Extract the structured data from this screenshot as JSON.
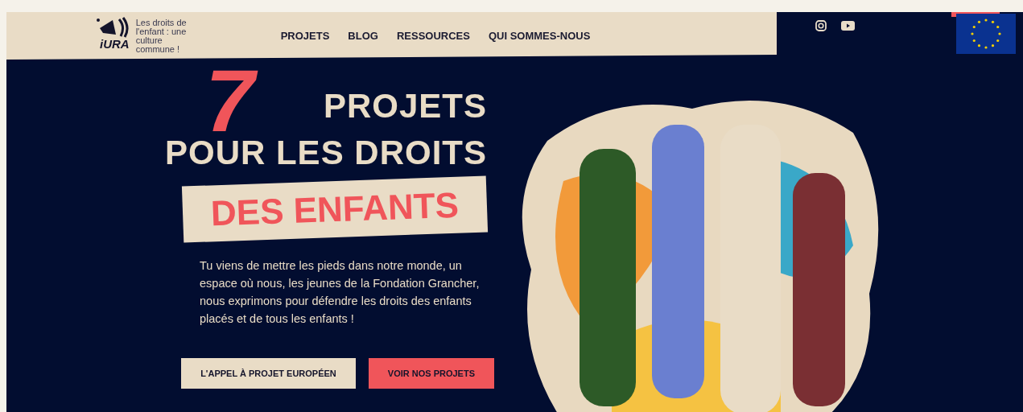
{
  "header": {
    "logo": {
      "wordmark": "iURA",
      "tagline": "Les droits de l'enfant : une culture commune !"
    },
    "nav": [
      "PROJETS",
      "BLOG",
      "RESSOURCES",
      "QUI SOMMES-NOUS"
    ],
    "social": [
      {
        "kind": "instagram"
      },
      {
        "kind": "youtube"
      }
    ]
  },
  "hero": {
    "number": "7",
    "title_lines": [
      "PROJETS",
      "POUR LES DROITS"
    ],
    "highlight": "DES ENFANTS",
    "intro": "Tu viens de mettre les pieds dans notre monde, un espace où nous, les jeunes de la Fondation Grancher, nous exprimons pour défendre les droits des enfants placés et de tous les enfants !",
    "buttons": [
      {
        "label": "L'APPEL À PROJET EUROPÉEN",
        "kind": "secondary"
      },
      {
        "label": "VOIR NOS PROJETS",
        "kind": "primary"
      }
    ]
  }
}
